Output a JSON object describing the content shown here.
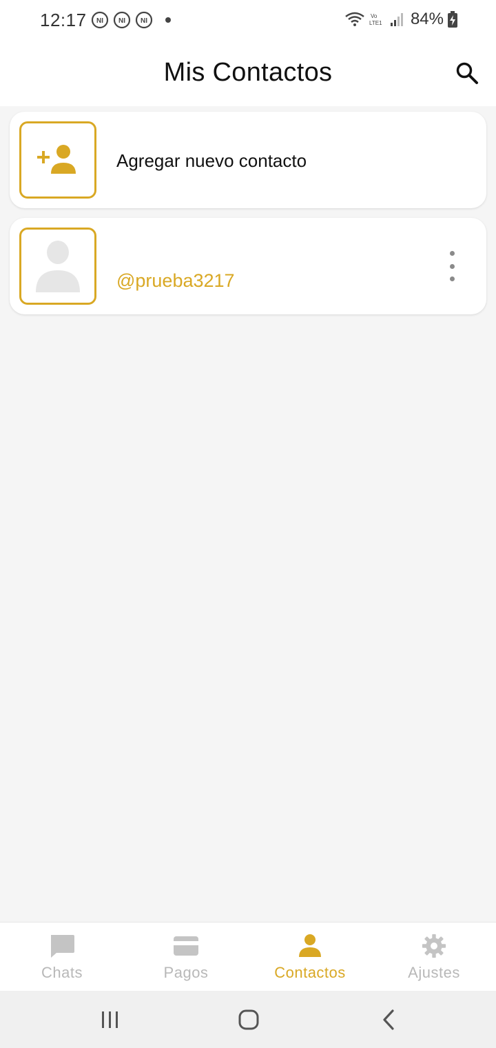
{
  "status_bar": {
    "time": "12:17",
    "notification_icons": [
      "ni-notification-icon",
      "ni-notification-icon",
      "ni-notification-icon"
    ],
    "battery": "84%",
    "network_label": "Vo LTE1"
  },
  "header": {
    "title": "Mis Contactos",
    "search_icon": "search-icon"
  },
  "contacts": {
    "add_label": "Agregar nuevo contacto",
    "items": [
      {
        "handle": "@prueba3217"
      }
    ]
  },
  "bottom_nav": {
    "items": [
      {
        "label": "Chats",
        "icon": "chat-icon",
        "active": false
      },
      {
        "label": "Pagos",
        "icon": "card-icon",
        "active": false
      },
      {
        "label": "Contactos",
        "icon": "person-icon",
        "active": true
      },
      {
        "label": "Ajustes",
        "icon": "gear-icon",
        "active": false
      }
    ]
  },
  "colors": {
    "accent": "#d9a824",
    "inactive": "#b8b8b8",
    "background": "#f5f5f5"
  }
}
